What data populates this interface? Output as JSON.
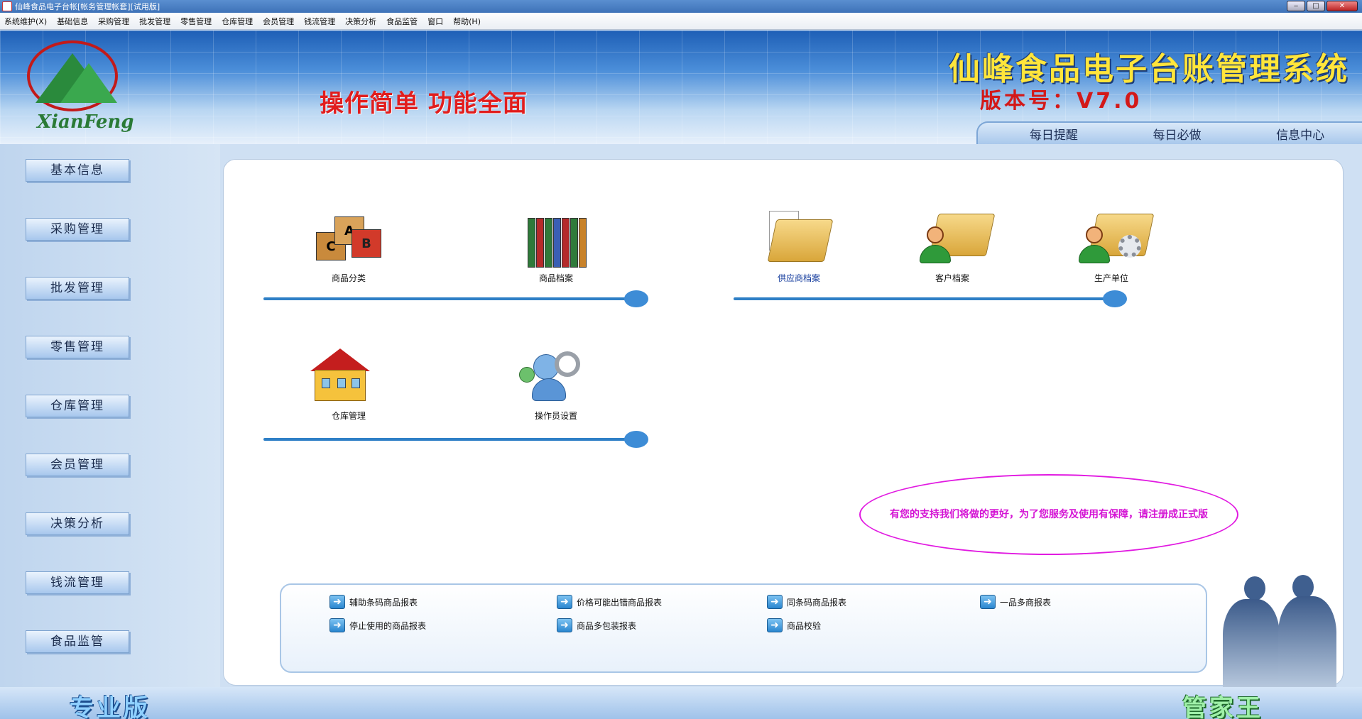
{
  "window": {
    "title": "仙峰食品电子台帐[帐务管理帐套][试用版]",
    "minimize": "‒",
    "maximize": "□",
    "close": "✕"
  },
  "menu": [
    "系统维护(X)",
    "基础信息",
    "采购管理",
    "批发管理",
    "零售管理",
    "仓库管理",
    "会员管理",
    "钱流管理",
    "决策分析",
    "食品监管",
    "窗口",
    "帮助(H)"
  ],
  "banner": {
    "logo_text": "XianFeng",
    "slogan": "操作简单 功能全面",
    "system_title": "仙峰食品电子台账管理系统",
    "version": "版本号：V7.0",
    "quicknav": [
      "每日提醒",
      "每日必做",
      "信息中心"
    ]
  },
  "sidebar": [
    "基本信息",
    "采购管理",
    "批发管理",
    "零售管理",
    "仓库管理",
    "会员管理",
    "决策分析",
    "钱流管理",
    "食品监管"
  ],
  "tiles": {
    "category": "商品分类",
    "archive": "商品档案",
    "supplier": "供应商档案",
    "customer": "客户档案",
    "producer": "生产单位",
    "warehouse": "仓库管理",
    "operator": "操作员设置",
    "blocks_letters": [
      "C",
      "A",
      "B"
    ]
  },
  "notice": "有您的支持我们将做的更好，为了您服务及使用有保障，请注册成正式版",
  "reports": [
    "辅助条码商品报表",
    "价格可能出错商品报表",
    "同条码商品报表",
    "一品多商报表",
    "停止使用的商品报表",
    "商品多包装报表",
    "商品校验"
  ],
  "footer": {
    "left": "专业版",
    "right": "管家王"
  }
}
